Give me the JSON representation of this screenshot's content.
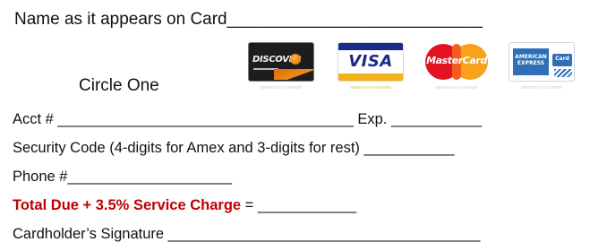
{
  "form": {
    "name_on_card": "Name as it appears on Card___________________________",
    "circle_one": "Circle One",
    "cards": [
      {
        "label": "DISCOVER",
        "icon": "discover-card-icon"
      },
      {
        "label": "VISA",
        "icon": "visa-card-icon"
      },
      {
        "label": "MasterCard",
        "icon": "mastercard-card-icon"
      },
      {
        "label": "AMERICAN EXPRESS",
        "card_word": "Card",
        "icon": "amex-card-icon"
      }
    ],
    "acct": "Acct # ____________________________________ Exp. ___________",
    "security_code": "Security Code (4-digits for Amex and 3-digits for rest) ___________",
    "phone": "Phone #____________________",
    "total_due_label": "Total Due + 3.5% Service Charge",
    "total_due_rest": " = ____________",
    "signature": "Cardholder’s Signature ______________________________________"
  },
  "colors": {
    "text": "#111111",
    "total_due": "#c00000"
  }
}
